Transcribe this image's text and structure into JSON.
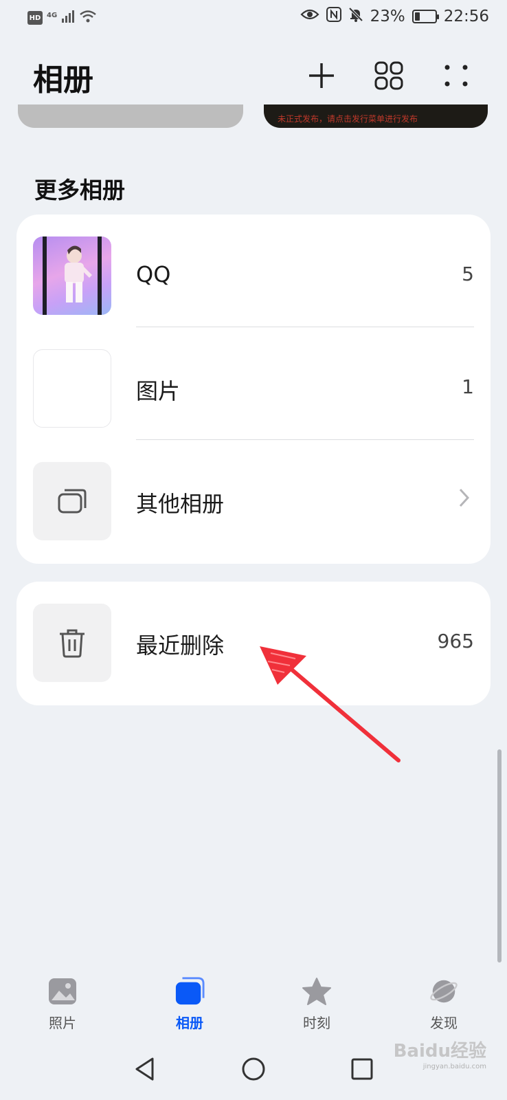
{
  "status_bar": {
    "hd": "HD",
    "network": "4G",
    "battery_text": "23%",
    "battery_level": 0.23,
    "time": "22:56",
    "icons": [
      "signal-icon",
      "wifi-icon",
      "eye-icon",
      "nfc-icon",
      "mute-bell-icon",
      "battery-icon"
    ]
  },
  "header": {
    "title": "相册",
    "actions": [
      "add-icon",
      "grid-icon",
      "more-icon"
    ]
  },
  "scrolled_banner_text": "未正式发布，请点击发行菜单进行发布",
  "section": {
    "title": "更多相册"
  },
  "albums": [
    {
      "label": "QQ",
      "count": "5"
    },
    {
      "label": "图片",
      "count": "1"
    },
    {
      "label": "其他相册",
      "count": ""
    }
  ],
  "deleted": {
    "label": "最近删除",
    "count": "965"
  },
  "bottom_nav": {
    "items": [
      {
        "label": "照片",
        "icon": "photos-icon"
      },
      {
        "label": "相册",
        "icon": "albums-icon",
        "active": true
      },
      {
        "label": "时刻",
        "icon": "moments-star-icon"
      },
      {
        "label": "发现",
        "icon": "discover-planet-icon"
      }
    ]
  },
  "colors": {
    "accent": "#0a59f7",
    "background": "#eef1f5",
    "card": "#ffffff",
    "annotation_arrow": "#f0303a"
  },
  "watermark": {
    "text": "Baidu经验",
    "sub": "jingyan.baidu.com"
  }
}
